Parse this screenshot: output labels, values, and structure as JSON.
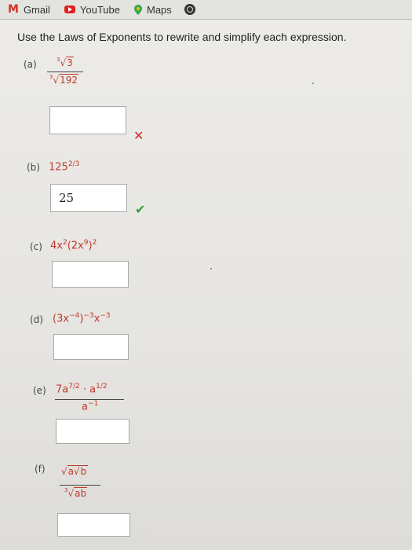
{
  "bookmarks": [
    {
      "label": "Gmail",
      "icon": "gmail-icon"
    },
    {
      "label": "YouTube",
      "icon": "youtube-icon"
    },
    {
      "label": "Maps",
      "icon": "maps-icon"
    }
  ],
  "question": "Use the Laws of Exponents to rewrite and simplify each expression.",
  "parts": [
    {
      "id": "a",
      "label": "(a)",
      "numerator": "3",
      "numerator_index": "3",
      "denominator": "192",
      "denominator_index": "3",
      "answer": "",
      "status": "incorrect"
    },
    {
      "id": "b",
      "label": "(b)",
      "base": "125",
      "exponent": "2/3",
      "answer": "25",
      "status": "correct"
    },
    {
      "id": "c",
      "label": "(c)",
      "coef": "4x",
      "exp1": "2",
      "inner": "(2x",
      "exp2": "9",
      "close": ")",
      "exp3": "2",
      "answer": ""
    },
    {
      "id": "d",
      "label": "(d)",
      "inner": "(3x",
      "exp1": "−4",
      "close": ")",
      "exp2": "−3",
      "tail": "x",
      "exp3": "−3",
      "answer": ""
    },
    {
      "id": "e",
      "label": "(e)",
      "num_a": "7a",
      "num_a_exp": "7/2",
      "dot": "·",
      "num_b": "a",
      "num_b_exp": "1/2",
      "den": "a",
      "den_exp": "−1",
      "answer": ""
    },
    {
      "id": "f",
      "label": "(f)",
      "num_a": "a",
      "num_b": "b",
      "den": "ab",
      "den_index": "3",
      "answer": ""
    }
  ],
  "marks": {
    "incorrect": "✕",
    "correct": "✔"
  }
}
